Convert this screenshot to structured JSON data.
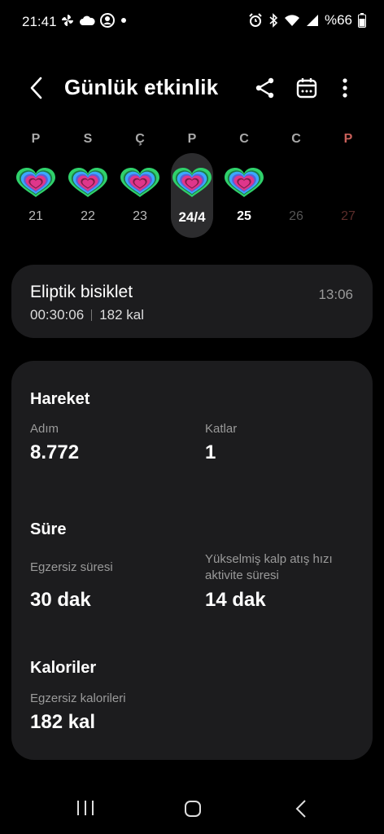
{
  "status_bar": {
    "time": "21:41",
    "battery": "%66",
    "icons_left": [
      "pinwheel-icon",
      "cloud-icon",
      "contact-icon",
      "dot-icon"
    ],
    "icons_right": [
      "alarm-icon",
      "bluetooth-icon",
      "wifi-icon",
      "signal-icon",
      "battery-icon"
    ]
  },
  "header": {
    "title": "Günlük etkinlik",
    "icons": [
      "back-arrow-icon",
      "share-icon",
      "calendar-icon",
      "more-vertical-icon"
    ]
  },
  "week": {
    "days": [
      {
        "dow": "P",
        "num": "21",
        "has_heart": true
      },
      {
        "dow": "S",
        "num": "22",
        "has_heart": true
      },
      {
        "dow": "Ç",
        "num": "23",
        "has_heart": true
      },
      {
        "dow": "P",
        "num": "24/4",
        "has_heart": true,
        "selected": true
      },
      {
        "dow": "C",
        "num": "25",
        "has_heart": true,
        "today": true
      },
      {
        "dow": "C",
        "num": "26",
        "has_heart": false
      },
      {
        "dow": "P",
        "num": "27",
        "has_heart": false
      }
    ]
  },
  "activity": {
    "name": "Eliptik bisiklet",
    "time": "13:06",
    "duration": "00:30:06",
    "calories": "182 kal"
  },
  "stats": {
    "movement": {
      "title": "Hareket",
      "steps_label": "Adım",
      "steps_value": "8.772",
      "floors_label": "Katlar",
      "floors_value": "1"
    },
    "duration": {
      "title": "Süre",
      "exercise_label": "Egzersiz süresi",
      "exercise_value": "30 dak",
      "hr_label_line1": "Yükselmiş kalp atış hızı",
      "hr_label_line2": "aktivite süresi",
      "hr_value": "14 dak"
    },
    "calories": {
      "title": "Kaloriler",
      "exercise_cal_label": "Egzersiz kalorileri",
      "exercise_cal_value": "182 kal"
    }
  },
  "colors": {
    "background": "#000000",
    "card": "#1c1c1e",
    "heart_outer": "#2fd16b",
    "heart_mid": "#3aa8ff",
    "heart_inner": "#e0368b",
    "sunday": "#c9605a"
  }
}
